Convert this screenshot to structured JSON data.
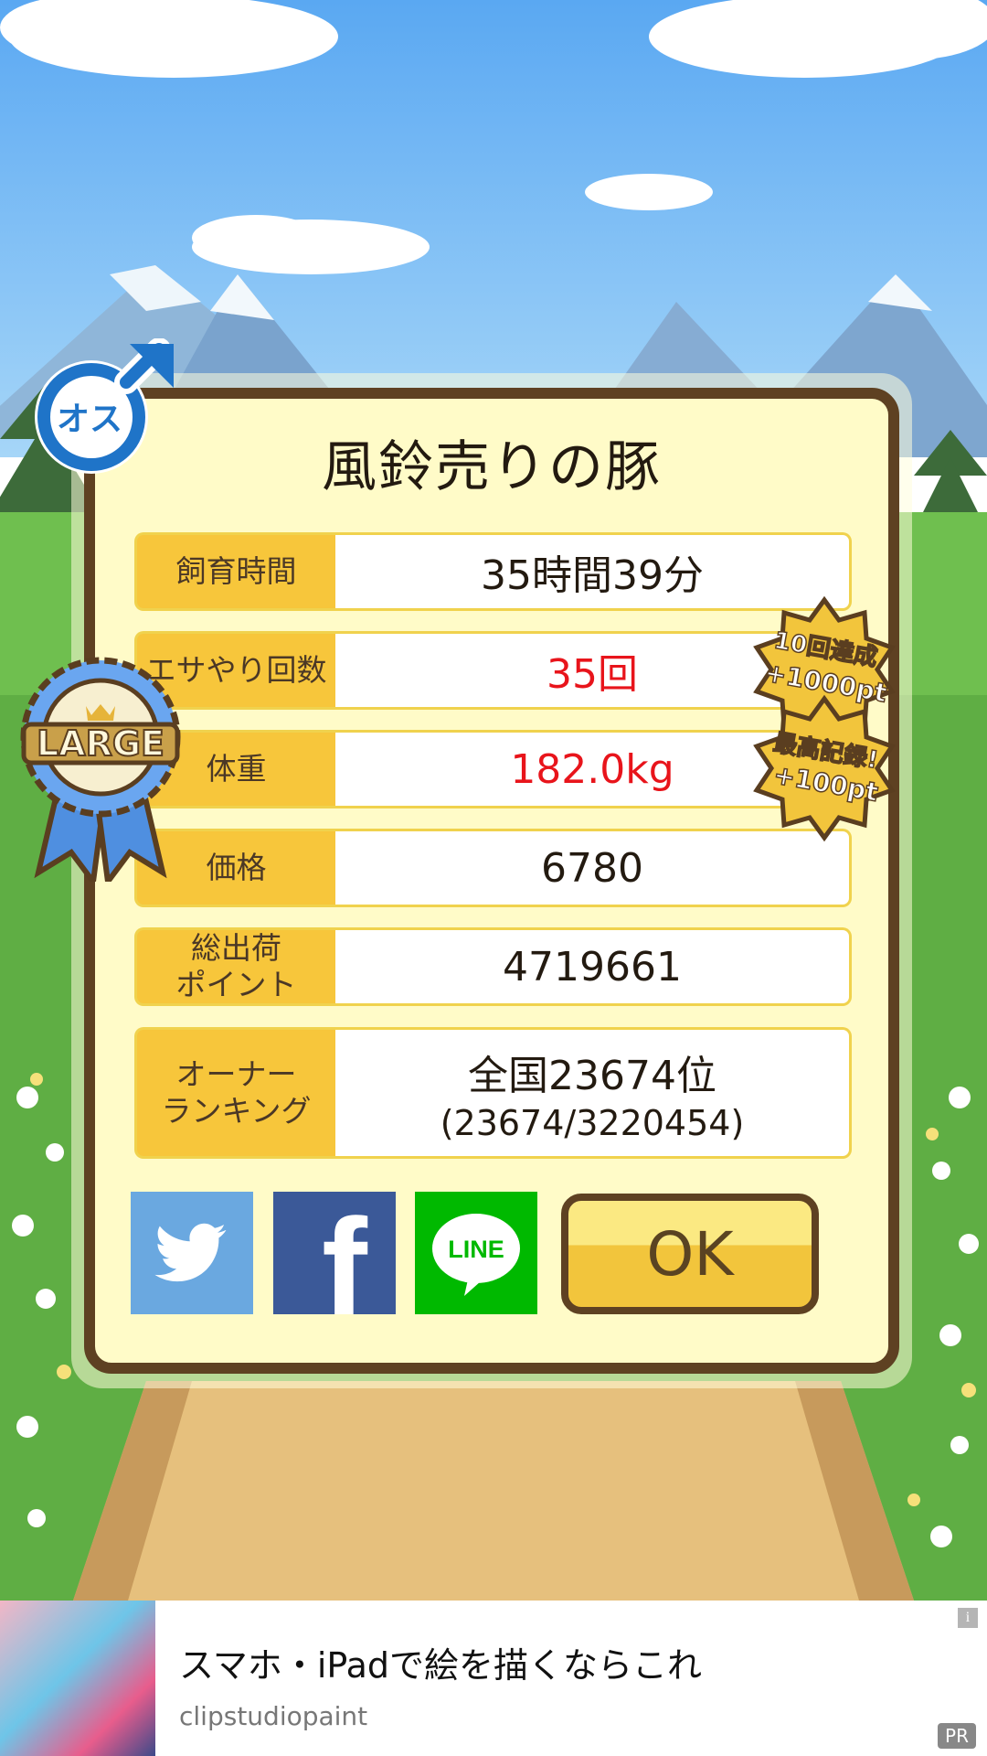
{
  "dialog": {
    "title": "風鈴売りの豚",
    "gender_label": "オス",
    "size_badge": "LARGE",
    "rows": [
      {
        "label": "飼育時間",
        "value": "35時間39分"
      },
      {
        "label": "エサやり回数",
        "value": "35回"
      },
      {
        "label": "体重",
        "value": "182.0kg"
      },
      {
        "label": "価格",
        "value": "6780"
      },
      {
        "label": "総出荷\nポイント",
        "value": "4719661"
      },
      {
        "label": "オーナー\nランキング",
        "value": "全国23674位",
        "sub": "(23674/3220454)"
      }
    ],
    "bonuses": [
      {
        "line1": "10回達成",
        "line2": "+1000pt"
      },
      {
        "line1": "最高記録!",
        "line2": "+100pt"
      }
    ],
    "share": {
      "twitter_icon": "twitter-bird-icon",
      "facebook_label": "f",
      "line_label": "LINE"
    },
    "ok_label": "OK"
  },
  "ad": {
    "title": "スマホ・iPadで絵を描くならこれ",
    "domain": "clipstudiopaint",
    "info": "i",
    "pr": "PR"
  },
  "colors": {
    "panel_bg": "#fffbc8",
    "panel_border": "#5e4122",
    "label_bg": "#f7c63b",
    "highlight": "#e8141b",
    "sky": "#6fb6f0"
  }
}
